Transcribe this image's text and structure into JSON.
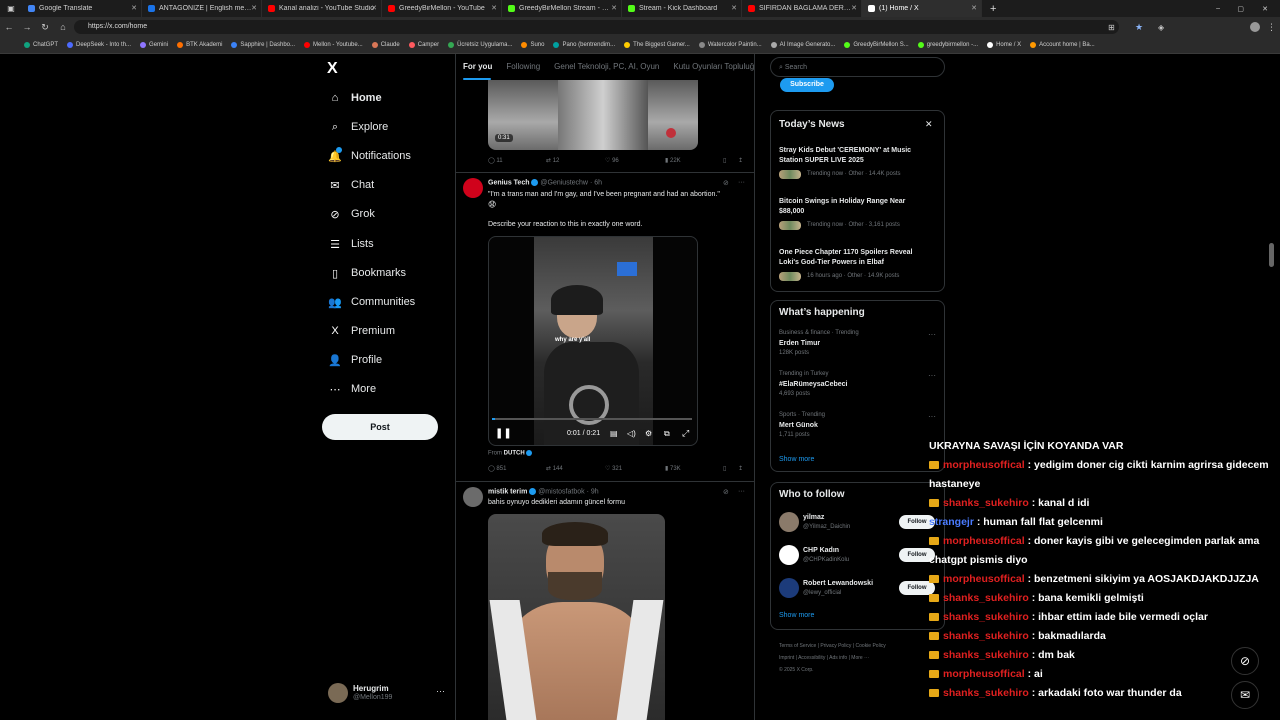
{
  "tabs": [
    {
      "label": "Google Translate",
      "color": "#4285f4"
    },
    {
      "label": "ANTAGONIZE | English meaning -",
      "color": "#1a73e8"
    },
    {
      "label": "Kanal analizi - YouTube Studio",
      "color": "#ff0000"
    },
    {
      "label": "GreedyBirMellon - YouTube",
      "color": "#ff0000"
    },
    {
      "label": "GreedyBirMellon Stream - Watch",
      "color": "#53fc18"
    },
    {
      "label": "Stream - Kick Dashboard",
      "color": "#53fc18"
    },
    {
      "label": "SIFIRDAN BAĞLAMA DERSİ 3 (EN",
      "color": "#ff0000"
    },
    {
      "label": "(1) Home / X",
      "color": "#ffffff"
    }
  ],
  "address": {
    "url": "https://x.com/home"
  },
  "bookmarks": [
    "ChatGPT",
    "DeepSeek - Into th...",
    "Gemini",
    "BTK Akademi",
    "Sapphire | Dashbo...",
    "Mellon - Youtube...",
    "Claude",
    "Camper",
    "Ücretsiz Uygulama...",
    "Suno",
    "Pano (bentrendim...",
    "The Biggest Gamer...",
    "Watercolor Paintin...",
    "AI Image Generato...",
    "GreedyBirMellon S...",
    "greedybirmellon -...",
    "Home / X",
    "Account home | Ba..."
  ],
  "nav": {
    "logo": "X",
    "items": [
      "Home",
      "Explore",
      "Notifications",
      "Chat",
      "Grok",
      "Lists",
      "Bookmarks",
      "Communities",
      "Premium",
      "Profile",
      "More"
    ],
    "post": "Post",
    "user_name": "Herugrim",
    "user_handle": "@Mellon199"
  },
  "feed": {
    "tabs": [
      "For you",
      "Following",
      "Genel Teknoloji, PC, AI, Oyun",
      "Kutu Oyunları Topluluğ"
    ],
    "top_video_time": "0:31",
    "top_actions": {
      "replies": "11",
      "reposts": "12",
      "likes": "96",
      "views": "22K"
    },
    "post1": {
      "name": "Genius Tech",
      "handle": "@Geniustechw",
      "time": "· 6h",
      "text1": "\"I'm a trans man and I'm gay, and I've been pregnant and had an abortion.\"",
      "text2": "Describe your reaction to this in exactly one word.",
      "caption": "why are y'all",
      "time_display": "0:01 / 0:21",
      "from_label": "From",
      "from_source": "DUTCH",
      "actions": {
        "replies": "851",
        "reposts": "144",
        "likes": "321",
        "views": "73K"
      }
    },
    "post2": {
      "name": "mistik terim",
      "handle": "@mistosfatbok",
      "time": "· 9h",
      "text": "bahis oynuyo dedikleri adamın güncel formu"
    }
  },
  "right": {
    "search_placeholder": "Search",
    "subscribe": "Subscribe",
    "news_title": "Today’s News",
    "news": [
      {
        "headline": "Stray Kids Debut 'CEREMONY' at Music Station SUPER LIVE 2025",
        "meta": "Trending now · Other · 14.4K posts"
      },
      {
        "headline": "Bitcoin Swings in Holiday Range Near $88,000",
        "meta": "Trending now · Other · 3,161 posts"
      },
      {
        "headline": "One Piece Chapter 1170 Spoilers Reveal Loki's God-Tier Powers in Elbaf",
        "meta": "16 hours ago · Other · 14.9K posts"
      }
    ],
    "happening_title": "What’s happening",
    "trends": [
      {
        "context": "Business & finance · Trending",
        "name": "Erden Timur",
        "posts": "128K posts"
      },
      {
        "context": "Trending in Turkey",
        "name": "#ElaRümeysaCebeci",
        "posts": "4,693 posts"
      },
      {
        "context": "Sports · Trending",
        "name": "Mert Günok",
        "posts": "1,711 posts"
      }
    ],
    "show_more": "Show more",
    "who_title": "Who to follow",
    "follow": [
      {
        "name": "yilmaz",
        "handle": "@Yilmaz_Daichin"
      },
      {
        "name": "CHP Kadın",
        "handle": "@CHPKadinKolu"
      },
      {
        "name": "Robert Lewandowski",
        "handle": "@lewy_official"
      }
    ],
    "follow_label": "Follow",
    "footer": [
      "Terms of Service",
      "Privacy Policy",
      "Cookie Policy",
      "Imprint",
      "Accessibility",
      "Ads info",
      "More ···",
      "© 2025 X Corp."
    ]
  },
  "chat": {
    "title": "UKRAYNA SAVAŞI İÇİN KOYANDA VAR",
    "messages": [
      {
        "user": "morpheusoffical",
        "msg": ": yedigim doner cig cikti karnim agrirsa gidecem hastaneye",
        "color": "#e02020",
        "crown": true
      },
      {
        "user": "shanks_sukehiro",
        "msg": ": kanal d idi",
        "color": "#e02020",
        "crown": true
      },
      {
        "user": "strangejr",
        "msg": ": human fall flat gelcenmi",
        "color": "#4a7bff",
        "crown": false
      },
      {
        "user": "morpheusoffical",
        "msg": ": doner kayis gibi ve gelecegimden parlak ama chatgpt pismis diyo",
        "color": "#e02020",
        "crown": true
      },
      {
        "user": "morpheusoffical",
        "msg": ": benzetmeni sikiyim ya AOSJAKDJAKDJJZJA",
        "color": "#e02020",
        "crown": true
      },
      {
        "user": "shanks_sukehiro",
        "msg": ": bana kemikli gelmişti",
        "color": "#e02020",
        "crown": true
      },
      {
        "user": "shanks_sukehiro",
        "msg": ": ihbar ettim iade bile vermedi oçlar",
        "color": "#e02020",
        "crown": true
      },
      {
        "user": "shanks_sukehiro",
        "msg": ": bakmadılarda",
        "color": "#e02020",
        "crown": true
      },
      {
        "user": "shanks_sukehiro",
        "msg": ": dm bak",
        "color": "#e02020",
        "crown": true
      },
      {
        "user": "morpheusoffical",
        "msg": ": ai",
        "color": "#e02020",
        "crown": true
      },
      {
        "user": "shanks_sukehiro",
        "msg": ": arkadaki foto war thunder da",
        "color": "#e02020",
        "crown": true
      }
    ]
  }
}
